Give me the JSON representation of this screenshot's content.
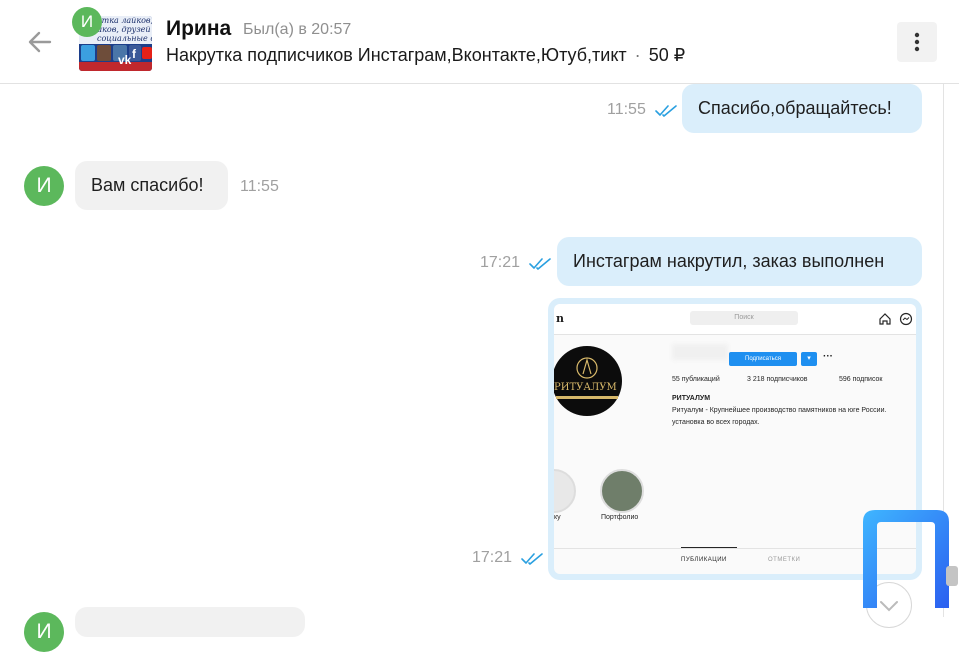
{
  "header": {
    "contact_name": "Ирина",
    "status": "Был(а) в 20:57",
    "avatar_letter": "И",
    "ad_title": "Накрутка подписчиков Инстаграм,Вконтакте,Ютуб,тикт",
    "ad_separator": "·",
    "ad_price": "50 ₽",
    "ad_image_text": [
      "утка лайков,",
      "иков, друзей",
      "социальные сети"
    ]
  },
  "messages": [
    {
      "direction": "out",
      "text": "Спасибо,обращайтесь!",
      "time": "11:55"
    },
    {
      "direction": "in",
      "text": "Вам спасибо!",
      "time": "11:55",
      "avatar_letter": "И"
    },
    {
      "direction": "out",
      "text": "Инстаграм накрутил, заказ выполнен",
      "time": "17:21"
    },
    {
      "direction": "out",
      "type": "image",
      "time": "17:21"
    },
    {
      "direction": "in",
      "avatar_letter": "И"
    }
  ],
  "screenshot": {
    "search_placeholder": "Поиск",
    "follow_label": "Подписаться",
    "posts": "55 публикаций",
    "followers": "3 218 подписчиков",
    "following": "596 подписок",
    "profile_name": "РИТУАЛУМ",
    "bio_line1": "Ритуалум - Крупнейшее производство памятников на юге России.",
    "bio_line2": "установка во всех городах.",
    "avatar_brand": "РИТУАЛУМ",
    "highlight_1_label": "ку",
    "highlight_2_label": "Портфолио",
    "tab_posts": "ПУБЛИКАЦИИ",
    "tab_tagged": "ОТМЕТКИ"
  },
  "colors": {
    "outgoing_bubble": "#daeefb",
    "incoming_bubble": "#f1f1f1",
    "avatar_green": "#5cb85c",
    "read_ticks": "#2aa0e0",
    "watermark": "#2a7cf5"
  }
}
